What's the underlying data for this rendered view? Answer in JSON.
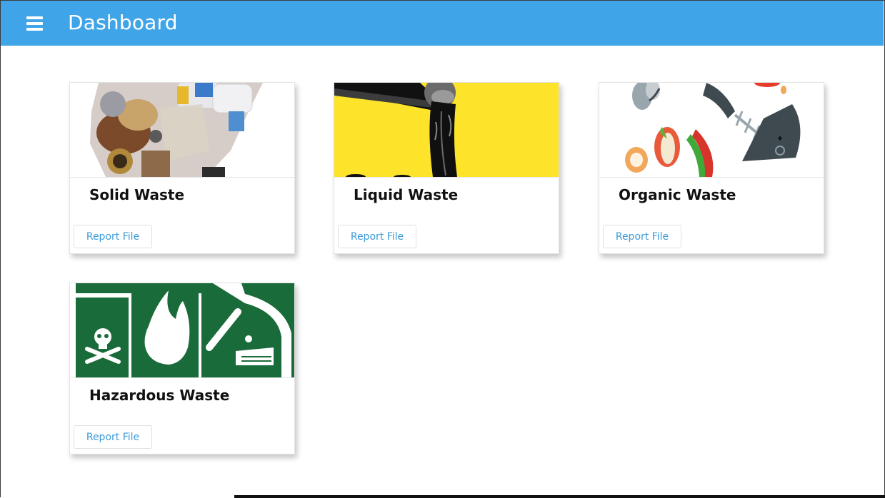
{
  "app": {
    "title": "Dashboard"
  },
  "cards": [
    {
      "title": "Solid Waste",
      "button": "Report File",
      "image": "solid-waste-image"
    },
    {
      "title": "Liquid Waste",
      "button": "Report File",
      "image": "liquid-waste-image"
    },
    {
      "title": "Organic Waste",
      "button": "Report File",
      "image": "organic-waste-image"
    },
    {
      "title": "Hazardous Waste",
      "button": "Report File",
      "image": "hazardous-waste-image"
    }
  ],
  "colors": {
    "appbar": "#40a5e8",
    "button_text": "#3a9ad9",
    "hazard_green": "#1a6b3a",
    "liquid_yellow": "#fde32a"
  }
}
